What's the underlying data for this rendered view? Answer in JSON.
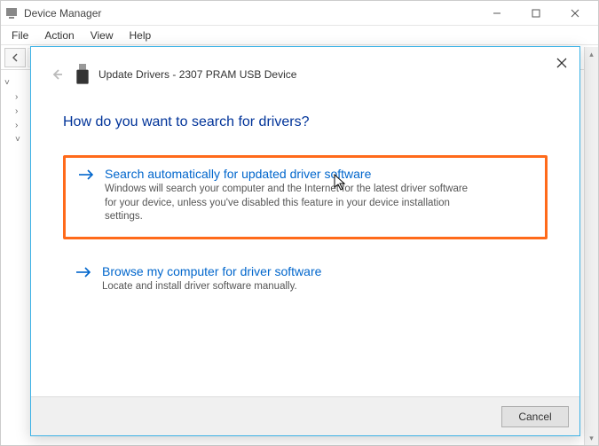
{
  "deviceManager": {
    "title": "Device Manager",
    "menu": {
      "file": "File",
      "action": "Action",
      "view": "View",
      "help": "Help"
    }
  },
  "dialog": {
    "headerPrefix": "Update Drivers - ",
    "deviceName": "2307 PRAM USB Device",
    "question": "How do you want to search for drivers?",
    "option1": {
      "title": "Search automatically for updated driver software",
      "desc": "Windows will search your computer and the Internet for the latest driver software for your device, unless you've disabled this feature in your device installation settings."
    },
    "option2": {
      "title": "Browse my computer for driver software",
      "desc": "Locate and install driver software manually."
    },
    "cancel": "Cancel"
  }
}
